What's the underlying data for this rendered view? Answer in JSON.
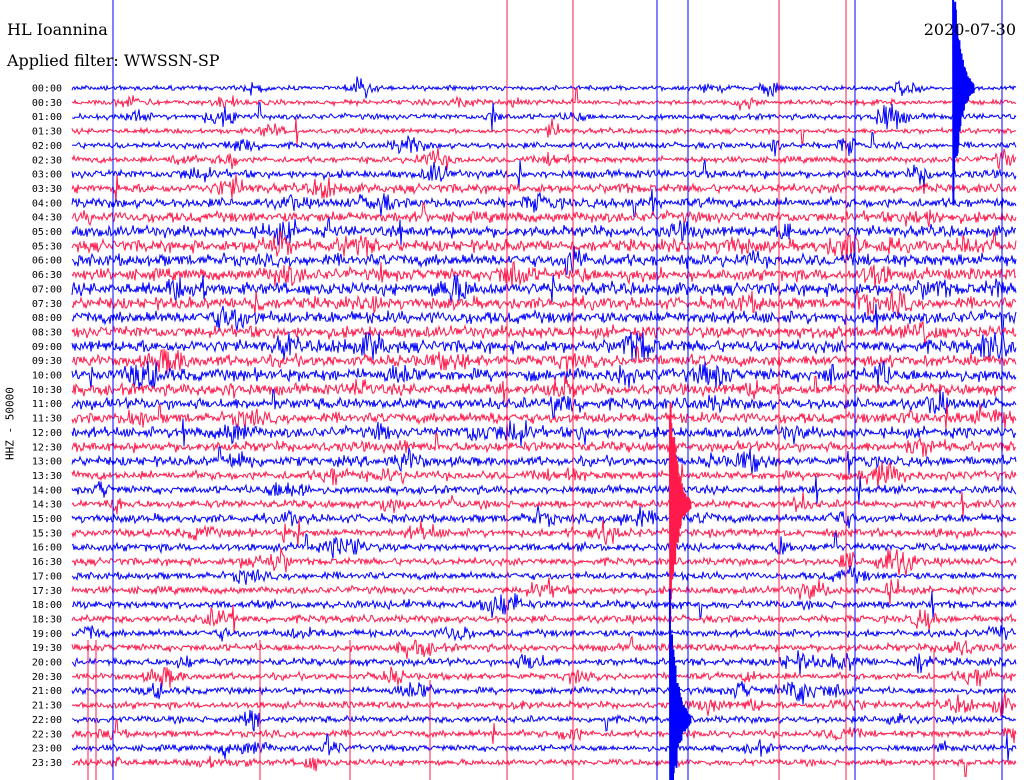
{
  "header": {
    "station": "HL Ioannina",
    "filter": "Applied filter: WWSSN-SP",
    "date": "2020-07-30"
  },
  "side_label": "HHZ - 50000",
  "colors": {
    "odd_row": "#0000ff",
    "even_row": "#ff1a4b",
    "background": "#ffffff"
  },
  "chart_data": {
    "type": "line",
    "title": "HL Ioannina",
    "subtitle": "Applied filter: WWSSN-SP",
    "date": "2020-07-30",
    "ylabel": "HHZ - 50000",
    "row_labels": [
      "00:00",
      "00:30",
      "01:00",
      "01:30",
      "02:00",
      "02:30",
      "03:00",
      "03:30",
      "04:00",
      "04:30",
      "05:00",
      "05:30",
      "06:00",
      "06:30",
      "07:00",
      "07:30",
      "08:00",
      "08:30",
      "09:00",
      "09:30",
      "10:00",
      "10:30",
      "11:00",
      "11:30",
      "12:00",
      "12:30",
      "13:00",
      "13:30",
      "14:00",
      "14:30",
      "15:00",
      "15:30",
      "16:00",
      "16:30",
      "17:00",
      "17:30",
      "18:00",
      "18:30",
      "19:00",
      "19:30",
      "20:00",
      "20:30",
      "21:00",
      "21:30",
      "22:00",
      "22:30",
      "23:00",
      "23:30"
    ],
    "row_minutes": 30,
    "row_activity": [
      0.15,
      0.2,
      0.25,
      0.2,
      0.3,
      0.3,
      0.45,
      0.55,
      0.6,
      0.7,
      0.75,
      0.8,
      0.85,
      0.8,
      0.85,
      0.8,
      0.85,
      0.8,
      0.85,
      0.8,
      0.85,
      0.75,
      0.75,
      0.7,
      0.7,
      0.65,
      0.6,
      0.5,
      0.45,
      0.45,
      0.5,
      0.45,
      0.45,
      0.4,
      0.4,
      0.4,
      0.45,
      0.4,
      0.4,
      0.4,
      0.4,
      0.35,
      0.35,
      0.35,
      0.35,
      0.35,
      0.3,
      0.3
    ],
    "events": [
      {
        "row": "00:00",
        "minute": 28,
        "amplitude": "large"
      },
      {
        "row": "14:30",
        "minute": 19,
        "amplitude": "large"
      },
      {
        "row": "22:00",
        "minute": 19,
        "amplitude": "large"
      }
    ],
    "grid": false
  }
}
